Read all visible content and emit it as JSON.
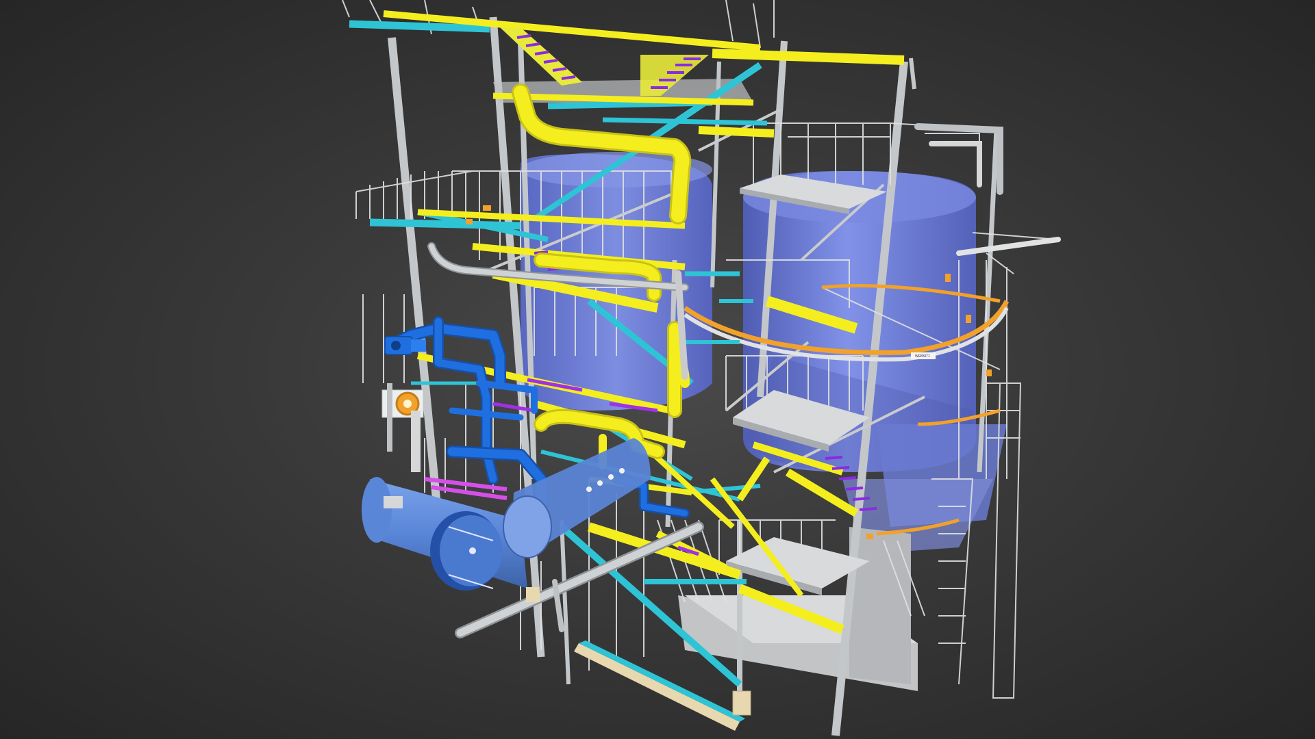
{
  "viewer": {
    "background_center": "#4a4a4a",
    "background_edge": "#262626"
  },
  "model": {
    "tag_label": "WEBSIT1"
  },
  "colors": {
    "steel": "#d2d4d6",
    "steel_dark": "#8f9396",
    "yellow": "#f4ee1f",
    "yellow_dark": "#c9c216",
    "cyan": "#2ec4d6",
    "cyan_dark": "#1b8e9c",
    "vessel": "#6f7fd9",
    "vessel_dark": "#4f5db3",
    "pipe_blue": "#1f6fe0",
    "pipe_blue_dark": "#1550a8",
    "drum_blue": "#5a86d8",
    "drum_blue_dark": "#3d62a8",
    "purple": "#8a2be2",
    "magenta": "#d64fe8",
    "orange": "#f2a12a",
    "beige": "#e8d8b0",
    "grey_pipe": "#b8bcc0",
    "platform": "#c9cbcd"
  }
}
